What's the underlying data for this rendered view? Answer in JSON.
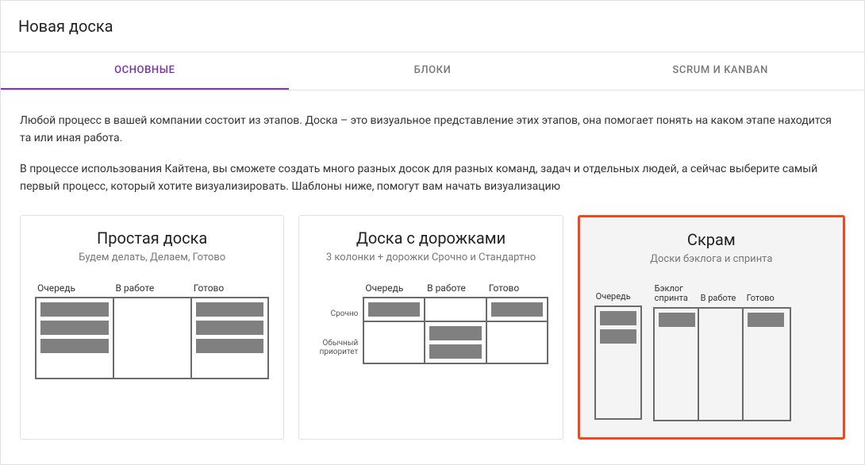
{
  "dialog": {
    "title": "Новая доска"
  },
  "tabs": {
    "main": "ОСНОВНЫЕ",
    "blocks": "БЛОКИ",
    "scrum_kanban": "SCRUM И KANBAN"
  },
  "description": {
    "p1": "Любой процесс в вашей компании состоит из этапов. Доска – это визуальное представление этих этапов, она помогает понять на каком этапе находится та или иная работа.",
    "p2": "В процессе использования Кайтена, вы сможете создать много разных досок для разных команд, задач и отдельных людей, а сейчас выберите самый первый процесс, который хотите визуализировать. Шаблоны ниже, помогут вам начать визуализацию"
  },
  "templates": {
    "simple": {
      "title": "Простая доска",
      "subtitle": "Будем делать, Делаем, Готово",
      "cols": {
        "queue": "Очередь",
        "wip": "В работе",
        "done": "Готово"
      }
    },
    "swimlanes": {
      "title": "Доска с дорожками",
      "subtitle": "3 колонки + дорожки Срочно и Стандартно",
      "cols": {
        "queue": "Очередь",
        "wip": "В работе",
        "done": "Готово"
      },
      "lanes": {
        "urgent": "Срочно",
        "normal": "Обычный приоритет"
      }
    },
    "scrum": {
      "title": "Скрам",
      "subtitle": "Доски бэклога и спринта",
      "backlog": {
        "queue": "Очередь"
      },
      "sprint": {
        "backlog": "Бэклог спринта",
        "wip": "В работе",
        "done": "Готово"
      }
    }
  }
}
